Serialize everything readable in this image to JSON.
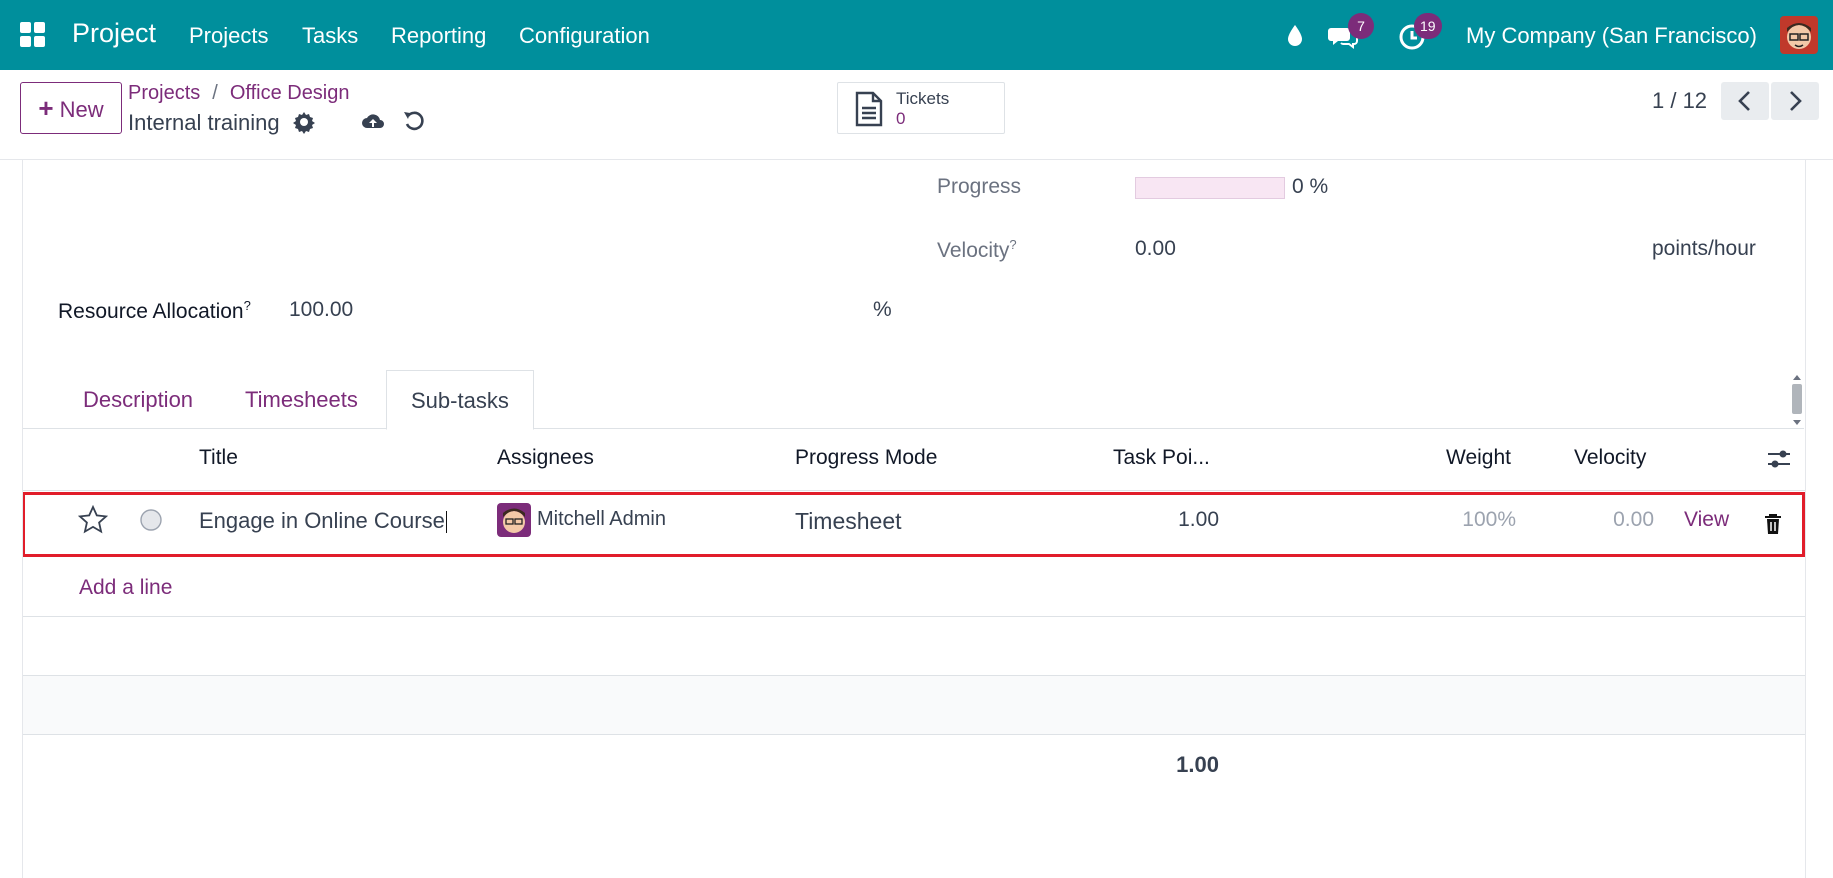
{
  "navbar": {
    "app_title": "Project",
    "menu": [
      "Projects",
      "Tasks",
      "Reporting",
      "Configuration"
    ],
    "messages_badge": "7",
    "activities_badge": "19",
    "company": "My Company (San Francisco)"
  },
  "control": {
    "new_label": "New",
    "breadcrumb": [
      "Projects",
      "Office Design"
    ],
    "breadcrumb_sep": "/",
    "record_title": "Internal training",
    "tickets_label": "Tickets",
    "tickets_count": "0",
    "pager": "1 / 12"
  },
  "form": {
    "progress_label": "Progress",
    "progress_value": "0 %",
    "progress_fraction": 0,
    "velocity_label": "Velocity",
    "velocity_help": "?",
    "velocity_value": "0.00",
    "velocity_unit": "points/hour",
    "resource_label": "Resource Allocation",
    "resource_help": "?",
    "resource_value": "100.00",
    "resource_unit": "%"
  },
  "tabs": [
    {
      "label": "Description",
      "active": false
    },
    {
      "label": "Timesheets",
      "active": false
    },
    {
      "label": "Sub-tasks",
      "active": true
    }
  ],
  "table": {
    "columns": [
      "Title",
      "Assignees",
      "Progress Mode",
      "Task Poi...",
      "Weight",
      "Velocity"
    ],
    "rows": [
      {
        "title": "Engage in Online Course",
        "assignee": "Mitchell Admin",
        "progress_mode": "Timesheet",
        "task_points": "1.00",
        "weight": "100%",
        "velocity": "0.00",
        "action": "View"
      }
    ],
    "add_line": "Add a line",
    "total_task_points": "1.00"
  },
  "colors": {
    "navbar": "#008f9c",
    "accent": "#7c2c7a",
    "highlight": "#e11d2a"
  }
}
